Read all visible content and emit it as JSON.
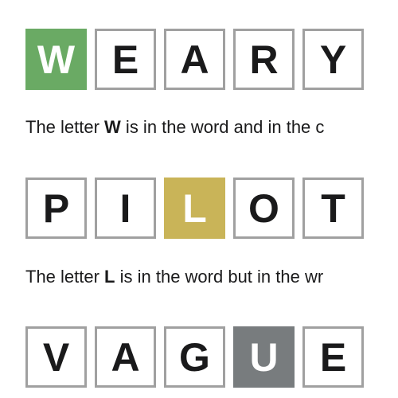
{
  "colors": {
    "correct": "#6aaa64",
    "present": "#c9b458",
    "absent": "#787c7e",
    "tile_border": "#a0a0a0",
    "text": "#1a1a1b"
  },
  "examples": [
    {
      "word": [
        {
          "letter": "W",
          "state": "correct"
        },
        {
          "letter": "E",
          "state": "empty"
        },
        {
          "letter": "A",
          "state": "empty"
        },
        {
          "letter": "R",
          "state": "empty"
        },
        {
          "letter": "Y",
          "state": "empty"
        }
      ],
      "explanation": {
        "prefix": "The letter ",
        "letter": "W",
        "suffix": " is in the word and in the c"
      }
    },
    {
      "word": [
        {
          "letter": "P",
          "state": "empty"
        },
        {
          "letter": "I",
          "state": "empty"
        },
        {
          "letter": "L",
          "state": "present"
        },
        {
          "letter": "O",
          "state": "empty"
        },
        {
          "letter": "T",
          "state": "empty"
        }
      ],
      "explanation": {
        "prefix": "The letter ",
        "letter": "L",
        "suffix": " is in the word but in the wr"
      }
    },
    {
      "word": [
        {
          "letter": "V",
          "state": "empty"
        },
        {
          "letter": "A",
          "state": "empty"
        },
        {
          "letter": "G",
          "state": "empty"
        },
        {
          "letter": "U",
          "state": "absent"
        },
        {
          "letter": "E",
          "state": "empty"
        }
      ]
    }
  ]
}
